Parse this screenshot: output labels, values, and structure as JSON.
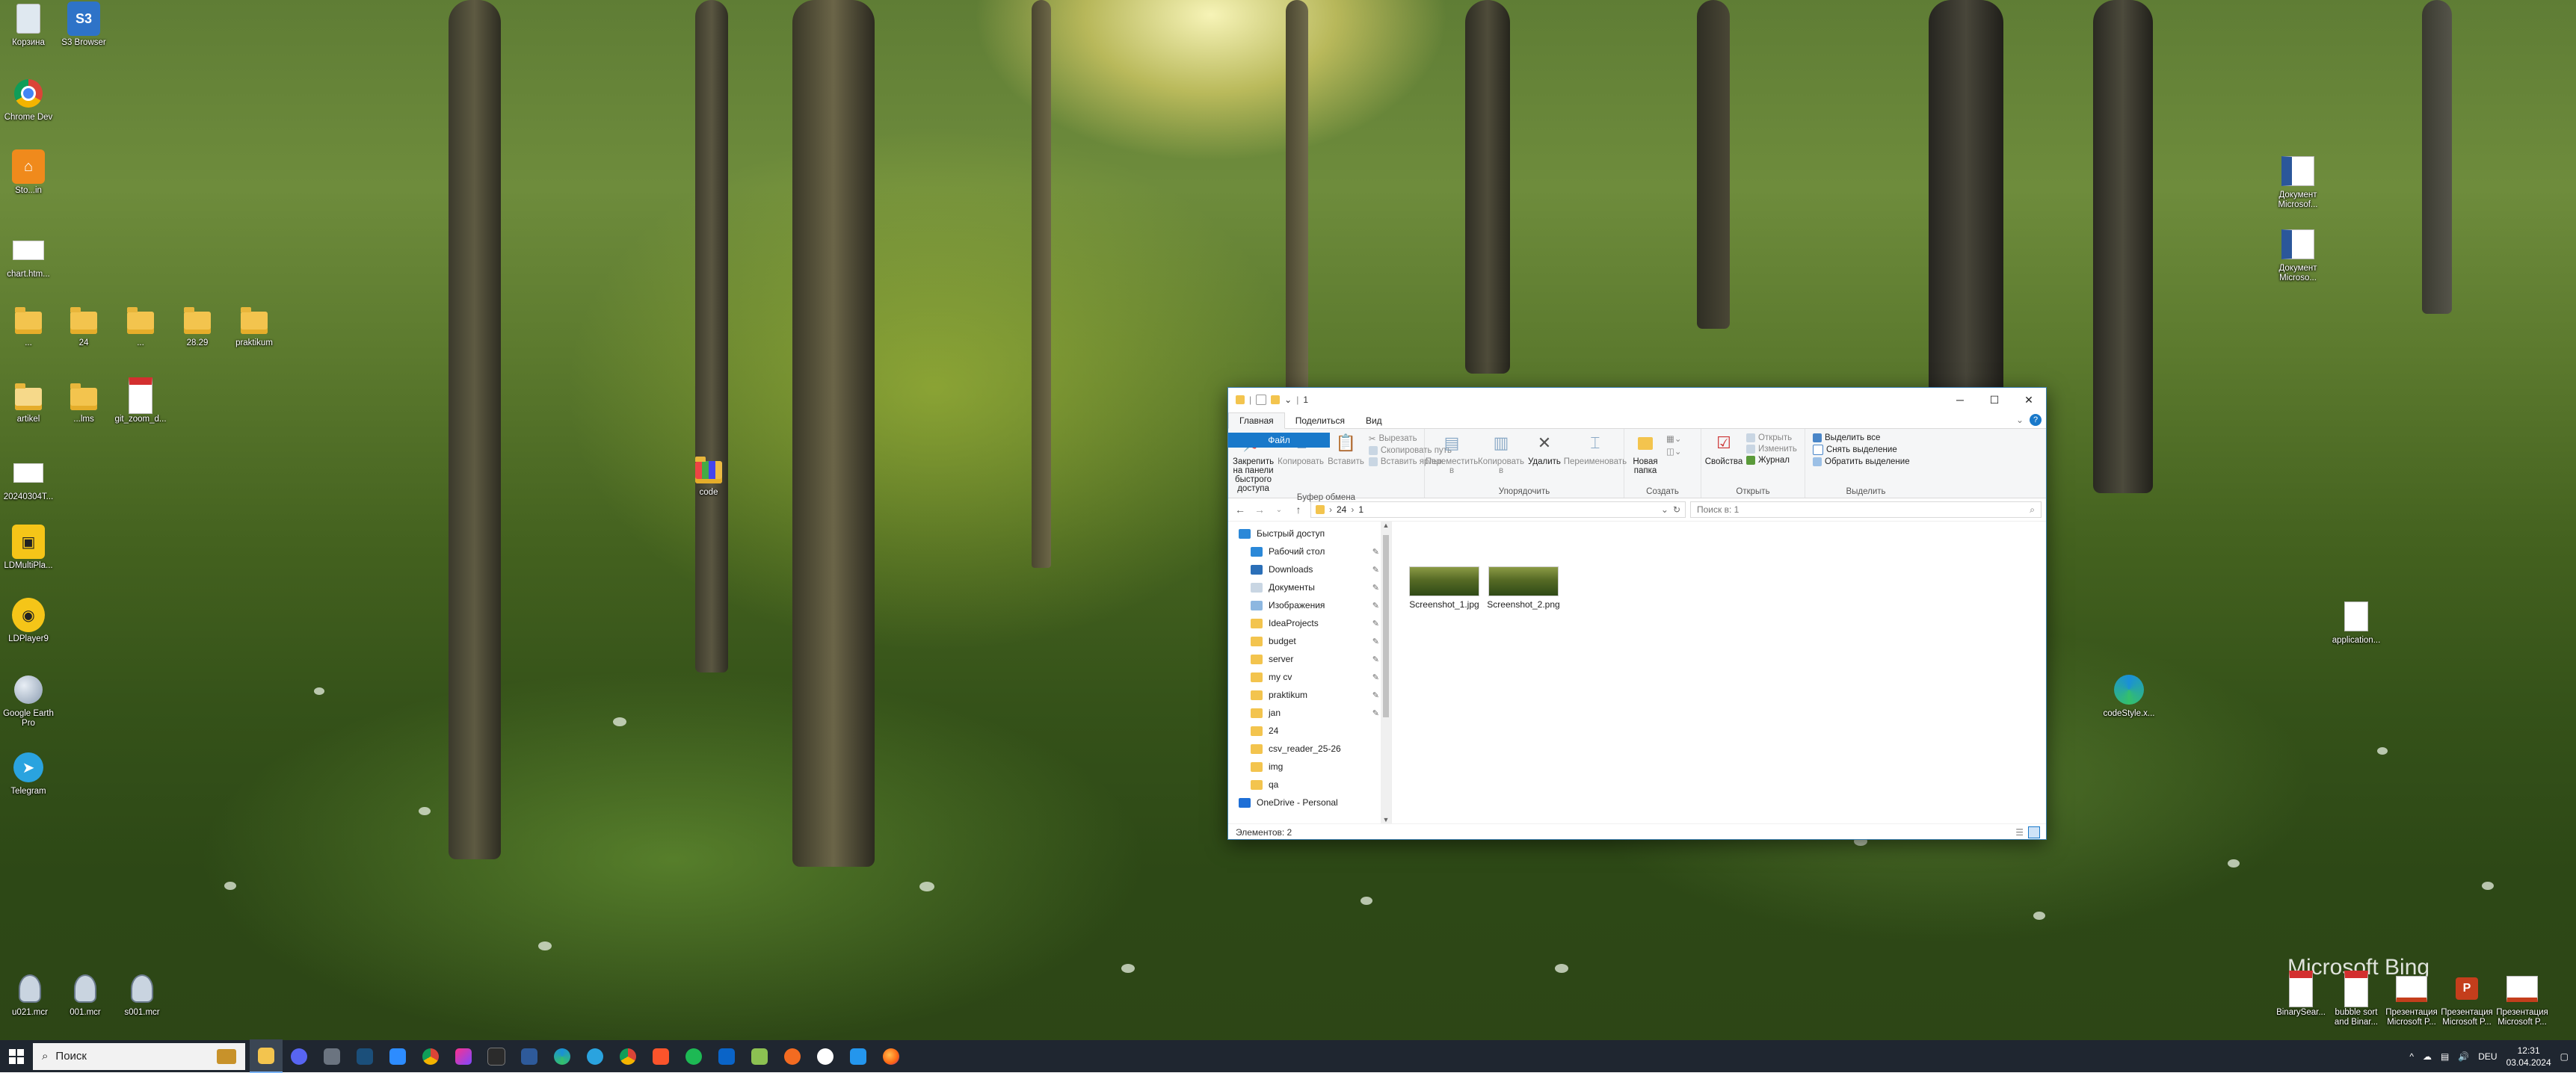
{
  "desktop": {
    "icons_left": [
      {
        "name": "recycle-bin-icon",
        "label": "Корзина"
      },
      {
        "name": "s3-browser-icon",
        "label": "S3 Browser"
      },
      {
        "name": "chrome-dev-icon",
        "label": "Chrome Dev"
      },
      {
        "name": "app-orange-icon",
        "label": "Sto...in"
      },
      {
        "name": "chart-file-icon",
        "label": "chart.htm..."
      },
      {
        "name": "folder-icon",
        "label": "..."
      },
      {
        "name": "folder-icon",
        "label": "24"
      },
      {
        "name": "folder-icon",
        "label": "..."
      },
      {
        "name": "folder-icon",
        "label": "28.29"
      },
      {
        "name": "folder-icon",
        "label": "praktikum"
      },
      {
        "name": "doc-icon",
        "label": "artikel"
      },
      {
        "name": "folder-icon",
        "label": "...lms"
      },
      {
        "name": "pdf-icon",
        "label": "git_zoom_d..."
      },
      {
        "name": "file-icon",
        "label": "20240304T..."
      },
      {
        "name": "ldmultiplayer-icon",
        "label": "LDMultiPla..."
      },
      {
        "name": "ldplayer-icon",
        "label": "LDPlayer9"
      },
      {
        "name": "google-earth-icon",
        "label": "Google Earth Pro"
      },
      {
        "name": "telegram-icon",
        "label": "Telegram"
      },
      {
        "name": "code-archive-icon",
        "label": "code"
      },
      {
        "name": "mcr-file-icon",
        "label": "u021.mcr"
      },
      {
        "name": "mcr-file-icon",
        "label": "001.mcr"
      },
      {
        "name": "mcr-file-icon",
        "label": "s001.mcr"
      }
    ],
    "icons_right": [
      {
        "name": "word-doc-icon",
        "label": "Документ Microsof..."
      },
      {
        "name": "word-doc-icon",
        "label": "Документ Microso..."
      },
      {
        "name": "file-icon",
        "label": "application..."
      },
      {
        "name": "edge-icon",
        "label": "codeStyle.x..."
      },
      {
        "name": "pdf-icon",
        "label": "BinarySear..."
      },
      {
        "name": "pdf-icon",
        "label": "bubble sort and Binar..."
      },
      {
        "name": "ppt-icon",
        "label": "Презентация Microsoft P..."
      },
      {
        "name": "ppt-icon",
        "label": "Презентация Microsoft P..."
      },
      {
        "name": "ppt-icon",
        "label": "Презентация Microsoft P..."
      }
    ],
    "watermark": "Microsoft Bing"
  },
  "window": {
    "title": "1",
    "tabs": {
      "file": "Файл",
      "home": "Главная",
      "share": "Поделиться",
      "view": "Вид"
    },
    "ribbon": {
      "pin": "Закрепить на панели быстрого доступа",
      "copy": "Копировать",
      "paste": "Вставить",
      "cut": "Вырезать",
      "copy_path": "Скопировать путь",
      "paste_shortcut": "Вставить ярлык",
      "group_clipboard": "Буфер обмена",
      "move_to": "Переместить в",
      "copy_to": "Копировать в",
      "delete": "Удалить",
      "rename": "Переименовать",
      "group_organize": "Упорядочить",
      "new_folder": "Новая папка",
      "group_create": "Создать",
      "properties": "Свойства",
      "open": "Открыть",
      "edit": "Изменить",
      "history": "Журнал",
      "group_open": "Открыть",
      "select_all": "Выделить все",
      "select_none": "Снять выделение",
      "invert_selection": "Обратить выделение",
      "group_select": "Выделить"
    },
    "address": {
      "crumb1": "24",
      "crumb2": "1",
      "search_placeholder": "Поиск в: 1"
    },
    "nav_items": [
      {
        "label": "Быстрый доступ",
        "pinned": false
      },
      {
        "label": "Рабочий стол",
        "pinned": true
      },
      {
        "label": "Downloads",
        "pinned": true
      },
      {
        "label": "Документы",
        "pinned": true
      },
      {
        "label": "Изображения",
        "pinned": true
      },
      {
        "label": "IdeaProjects",
        "pinned": true
      },
      {
        "label": "budget",
        "pinned": true
      },
      {
        "label": "server",
        "pinned": true
      },
      {
        "label": "my cv",
        "pinned": true
      },
      {
        "label": "praktikum",
        "pinned": true
      },
      {
        "label": "jan",
        "pinned": true
      },
      {
        "label": "24",
        "pinned": false
      },
      {
        "label": "csv_reader_25-26",
        "pinned": false
      },
      {
        "label": "img",
        "pinned": false
      },
      {
        "label": "qa",
        "pinned": false
      },
      {
        "label": "OneDrive - Personal",
        "pinned": false
      }
    ],
    "files": [
      {
        "name": "Screenshot_1.jpg"
      },
      {
        "name": "Screenshot_2.png"
      }
    ],
    "status": "Элементов: 2"
  },
  "taskbar": {
    "search_placeholder": "Поиск",
    "language": "DEU",
    "time": "12:31",
    "date": "03.04.2024"
  }
}
